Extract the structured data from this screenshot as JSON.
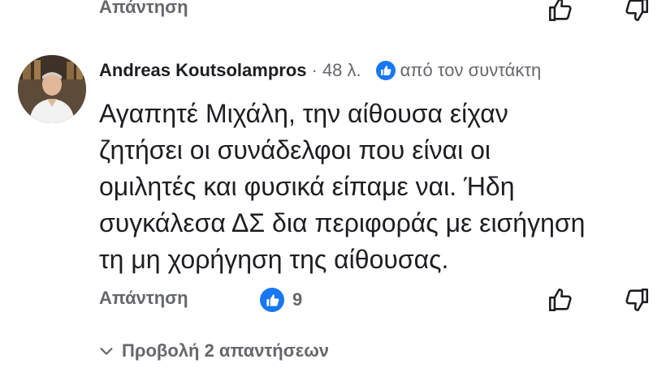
{
  "previous_comment": {
    "reply_label": "Απάντηση",
    "like_icon": "thumbs-up-outline",
    "dislike_icon": "thumbs-down-outline"
  },
  "comment": {
    "author": "Andreas Koutsolampros",
    "time": "· 48 λ.",
    "author_badge_icon": "like-badge",
    "by_author_label": "από τον συντάκτη",
    "text_lines": [
      "Αγαπητέ Μιχάλη, την αίθουσα είχαν",
      "ζητήσει οι συνάδελφοι που είναι οι",
      "ομιλητές και φυσικά είπαμε ναι. Ήδη",
      "συγκάλεσα ΔΣ δια περιφοράς με εισήγηση",
      "τη μη χορήγηση της αίθουσας."
    ],
    "reply_label": "Απάντηση",
    "like_count": "9",
    "view_replies_label": "Προβολή 2 απαντήσεων"
  },
  "colors": {
    "accent": "#1877f2",
    "muted_text": "#65676b",
    "primary_text": "#1c1e21",
    "background": "#ffffff"
  }
}
